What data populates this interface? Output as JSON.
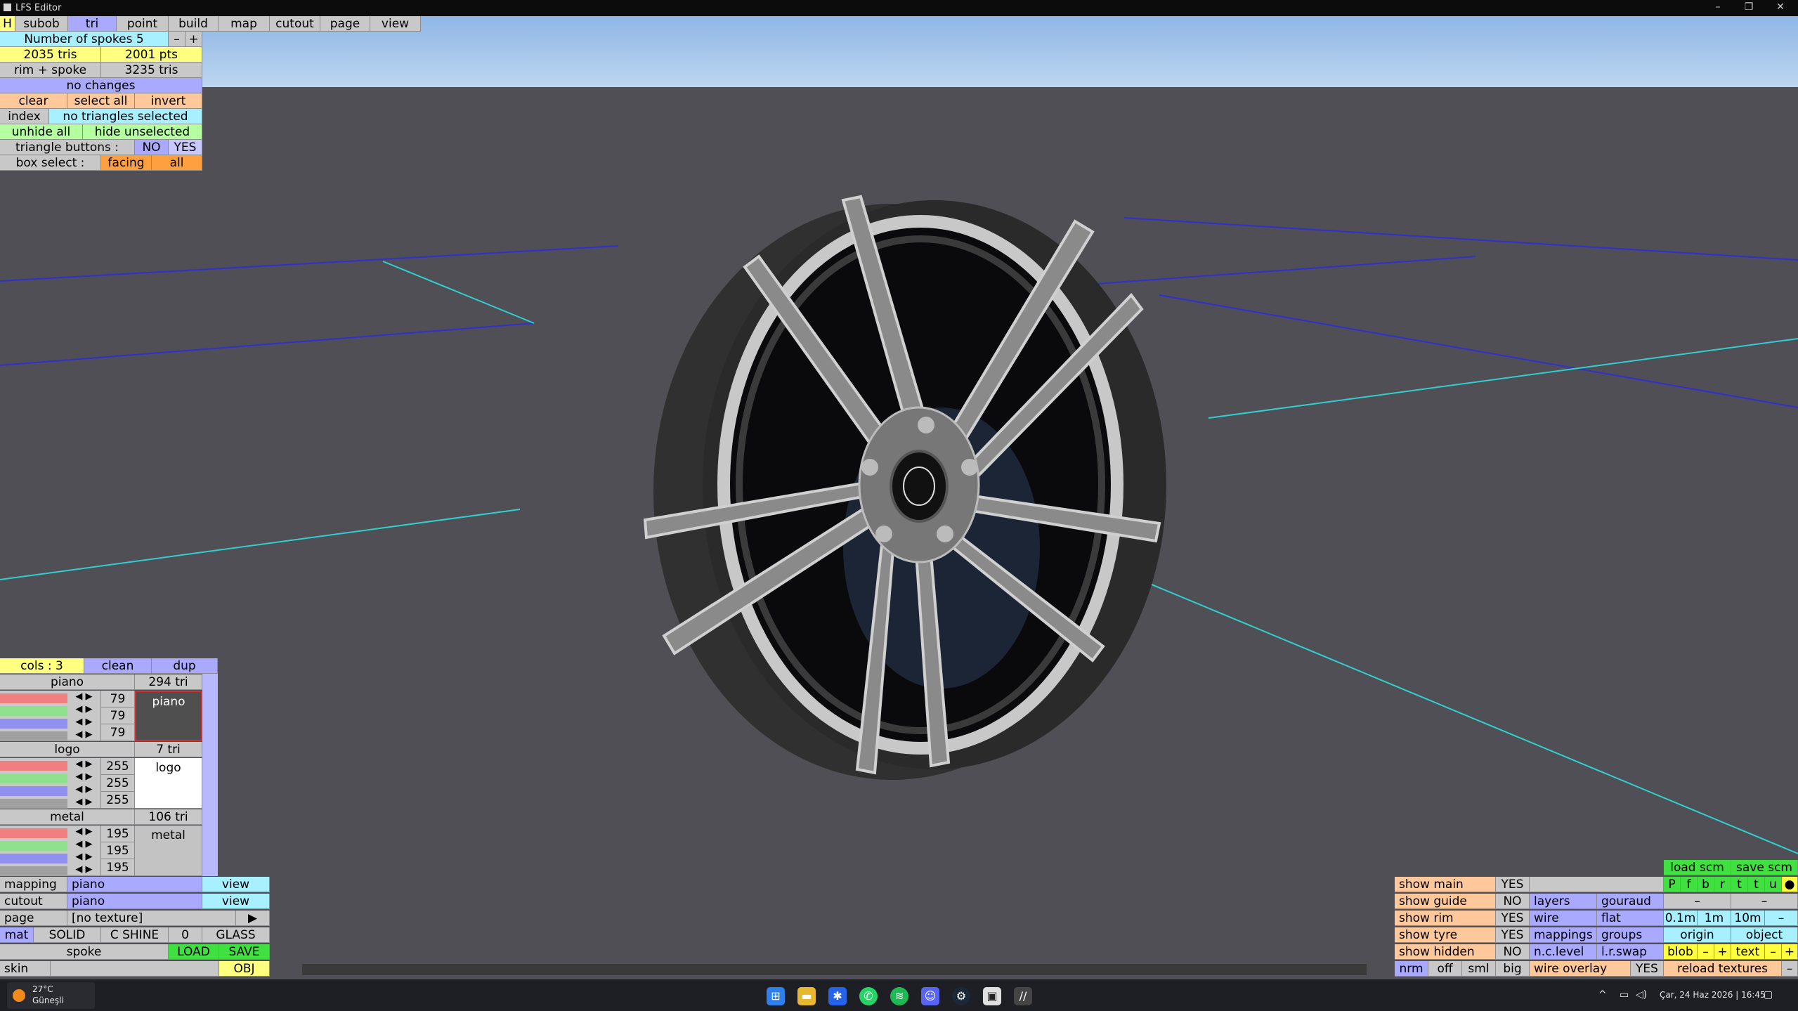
{
  "window": {
    "title": "LFS Editor",
    "controls": {
      "minimize": "–",
      "restore": "❐",
      "close": "✕"
    }
  },
  "menu": {
    "home": "H",
    "tabs": [
      "subob",
      "tri",
      "point",
      "build",
      "map",
      "cutout",
      "page",
      "view"
    ],
    "active": "tri"
  },
  "top_panel": {
    "spokes": {
      "label": "Number of spokes 5",
      "minus": "–",
      "plus": "+"
    },
    "tris": "2035 tris",
    "pts": "2001 pts",
    "rim_spoke": "rim + spoke",
    "rim_tris": "3235 tris",
    "status": "no changes",
    "clear": "clear",
    "select_all": "select all",
    "invert": "invert",
    "index": "index",
    "selection": "no triangles selected",
    "unhide_all": "unhide all",
    "hide_unselected": "hide unselected",
    "tri_buttons": {
      "label": "triangle buttons :",
      "no": "NO",
      "yes": "YES"
    },
    "box_select": {
      "label": "box select :",
      "facing": "facing",
      "all": "all"
    }
  },
  "colours": {
    "header": {
      "cols": "cols : 3",
      "clean": "clean",
      "dup": "dup"
    },
    "materials": [
      {
        "name": "piano",
        "tris": "294 tri",
        "r": "79",
        "g": "79",
        "b": "79",
        "swatch": "piano",
        "swatch_color": "#4f4f4f",
        "swatch_text": "#ffffff"
      },
      {
        "name": "logo",
        "tris": "7 tri",
        "r": "255",
        "g": "255",
        "b": "255",
        "swatch": "logo",
        "swatch_color": "#ffffff",
        "swatch_text": "#000000"
      },
      {
        "name": "metal",
        "tris": "106 tri",
        "r": "195",
        "g": "195",
        "b": "195",
        "swatch": "metal",
        "swatch_color": "#c3c3c3",
        "swatch_text": "#000000"
      }
    ]
  },
  "bottom_left": {
    "mapping": {
      "label": "mapping",
      "value": "piano",
      "action": "view"
    },
    "cutout": {
      "label": "cutout",
      "value": "piano",
      "action": "view"
    },
    "page": {
      "label": "page",
      "value": "[no texture]",
      "action": "▶"
    },
    "mat": {
      "label": "mat",
      "solid": "SOLID",
      "shine": "C SHINE",
      "shine_val": "0",
      "glass": "GLASS"
    },
    "spoke": {
      "label": "spoke",
      "load": "LOAD",
      "save": "SAVE"
    },
    "skin": {
      "label": "skin",
      "obj": "OBJ"
    }
  },
  "bottom_right": {
    "load_scm": "load scm",
    "save_scm": "save scm",
    "flags": [
      "P",
      "f",
      "b",
      "r",
      "t",
      "t",
      "u",
      "●"
    ],
    "rows": [
      {
        "label": "show main",
        "val": "YES"
      },
      {
        "label": "show guide",
        "val": "NO"
      },
      {
        "label": "show rim",
        "val": "YES"
      },
      {
        "label": "show tyre",
        "val": "YES"
      },
      {
        "label": "show hidden",
        "val": "NO"
      }
    ],
    "layers": "layers",
    "gouraud": "gouraud",
    "wire": "wire",
    "flat": "flat",
    "d1": "0.1m",
    "d2": "1m",
    "d3": "10m",
    "dminus": "–",
    "dash1": "–",
    "dash2": "–",
    "mappings": "mappings",
    "groups": "groups",
    "origin": "origin",
    "object": "object",
    "nclevel": "n.c.level",
    "lrswap": "l.r.swap",
    "blob": "blob",
    "text": "text",
    "m": "–",
    "p": "+",
    "nrm": "nrm",
    "off": "off",
    "sml": "sml",
    "big": "big",
    "wire_overlay": "wire overlay",
    "wo_val": "YES",
    "reload": "reload textures",
    "rminus": "–"
  },
  "taskbar": {
    "weather_temp": "27°C",
    "weather_desc": "Güneşli",
    "datetime": "Çar, 24 Haz 2026 | 16:45",
    "apps": [
      "start-icon",
      "files-icon",
      "gear-app-icon",
      "whatsapp-icon",
      "spotify-icon",
      "discord-icon",
      "steam-icon",
      "app-icon",
      "lfs-icon"
    ]
  }
}
